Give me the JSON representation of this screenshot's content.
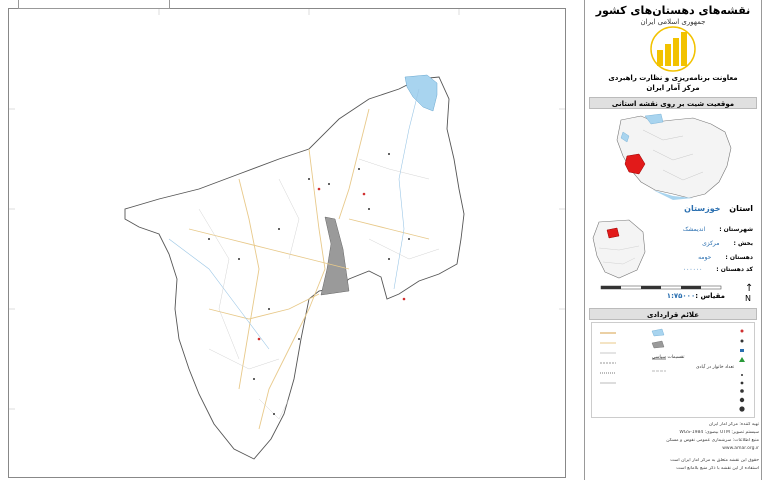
{
  "panel": {
    "title": "نقشه‌های دهستان‌های کشور",
    "subtitle": "جمهوری اسلامی ایران",
    "org_line1": "معاونت برنامه‌ریزی و نظارت راهبردی",
    "org_line2": "مرکز آمار ایران",
    "location_heading": "موقعیت شیت بر روی نقشه استانی",
    "province_label": "استان",
    "province_value": "خوزستان",
    "info": [
      {
        "label": "شهرستان :",
        "value": "اندیمشک"
      },
      {
        "label": "بخش :",
        "value": "مرکزی"
      },
      {
        "label": "دهستان :",
        "value": "حومه"
      },
      {
        "label": "کد دهستان :",
        "value": "۰۰۰۰۰۰"
      }
    ],
    "scale_label": "مقیاس :",
    "scale_value": "۱:۷۵۰۰۰",
    "north_label": "N",
    "legend_heading": "علائم قراردادی",
    "legend_subheading": "تقسیمات سیاسی",
    "legend_pop_heading": "تعداد خانوار در آبادی",
    "notes": [
      "تهیه کننده: مرکز آمار ایران",
      "سیستم تصویر: UTM     بیضوی: WGS-1984",
      "منبع اطلاعات: سرشماری عمومی نفوس و مسکن",
      "www.amar.org.ir",
      "حقوق این نقشه متعلق به مرکز آمار ایران است",
      "استفاده از این نقشه با ذکر منبع بلامانع است"
    ]
  },
  "colors": {
    "water": "#a8d4ef",
    "province_highlight": "#e21a1a",
    "road": "#e8c98a",
    "urban": "#9a9a9a",
    "logo": "#f2c200",
    "boundary": "#555555"
  }
}
